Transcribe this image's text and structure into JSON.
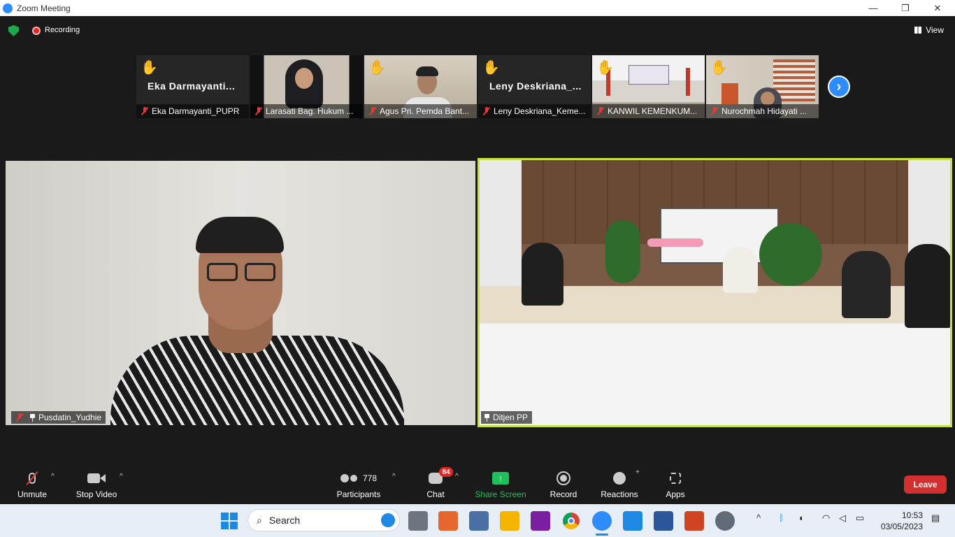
{
  "window": {
    "title": "Zoom Meeting",
    "minimize": "—",
    "maximize": "❐",
    "close": "✕"
  },
  "topbar": {
    "recording_label": "Recording",
    "view_label": "View"
  },
  "gallery": [
    {
      "display": "Eka  Darmayanti...",
      "name": "Eka Darmayanti_PUPR",
      "hand_raised": true,
      "video": false
    },
    {
      "display": "",
      "name": "Larasati Bag. Hukum ...",
      "hand_raised": false,
      "video": true
    },
    {
      "display": "",
      "name": "Agus Pri. Pemda Bant...",
      "hand_raised": true,
      "video": true
    },
    {
      "display": "Leny  Deskriana_...",
      "name": "Leny Deskriana_Keme...",
      "hand_raised": true,
      "video": false
    },
    {
      "display": "",
      "name": "KANWIL KEMENKUM...",
      "hand_raised": true,
      "video": true
    },
    {
      "display": "",
      "name": "Nurochmah Hidayati ...",
      "hand_raised": true,
      "video": true
    }
  ],
  "main_videos": {
    "left_name": "Pusdatin_Yudhie",
    "right_name": "Ditjen PP"
  },
  "toolbar": {
    "unmute": "Unmute",
    "stop_video": "Stop Video",
    "participants": "Participants",
    "participants_count": "778",
    "chat": "Chat",
    "chat_badge": "84",
    "share_screen": "Share Screen",
    "record": "Record",
    "reactions": "Reactions",
    "apps": "Apps",
    "leave": "Leave"
  },
  "taskbar": {
    "search_placeholder": "Search",
    "time": "10:53",
    "date": "03/05/2023"
  },
  "colors": {
    "accent": "#2d8cff",
    "share_green": "#20c05c",
    "leave_red": "#d32f2f",
    "active_speaker": "#c8e23c"
  }
}
